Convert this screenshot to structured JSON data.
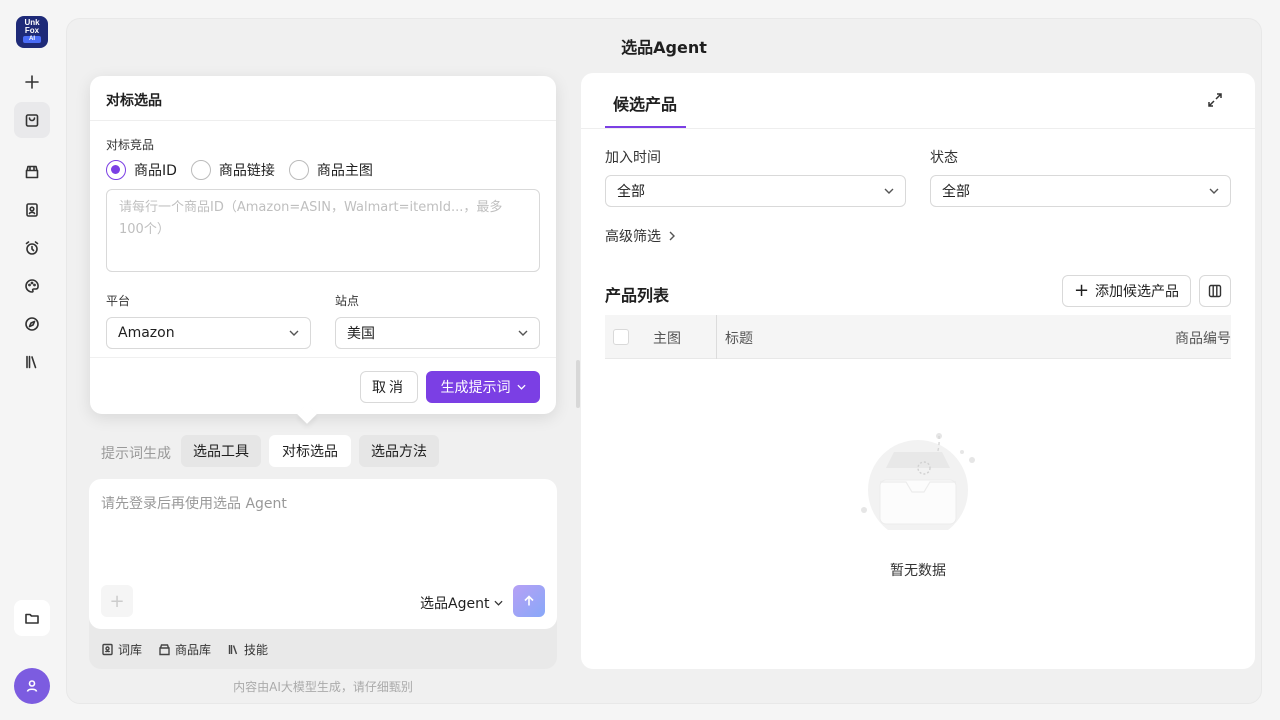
{
  "app": {
    "logo_line1": "Unk",
    "logo_line2": "Fox",
    "logo_badge": "AI",
    "page_title": "选品Agent"
  },
  "rail": {
    "icons": [
      "plus-icon",
      "shopping-bag-icon",
      "store-icon",
      "contacts-icon",
      "alarm-clock-icon",
      "palette-icon",
      "compass-icon",
      "library-icon",
      "folder-icon",
      "user-icon"
    ]
  },
  "popover": {
    "title": "对标选品",
    "competitor_label": "对标竞品",
    "radio_options": [
      "商品ID",
      "商品链接",
      "商品主图"
    ],
    "selected_radio": "商品ID",
    "textarea_placeholder": "请每行一个商品ID（Amazon=ASIN，Walmart=itemId...，最多100个）",
    "platform_label": "平台",
    "platform_value": "Amazon",
    "site_label": "站点",
    "site_value": "美国",
    "cancel_label": "取消",
    "generate_label": "生成提示词"
  },
  "prompt": {
    "label": "提示词生成",
    "chips": [
      "选品工具",
      "对标选品",
      "选品方法"
    ],
    "selected_chip": "对标选品"
  },
  "chat": {
    "placeholder": "请先登录后再使用选品 Agent",
    "agent_select": "选品Agent",
    "tools": [
      "词库",
      "商品库",
      "技能"
    ],
    "disclaimer": "内容由AI大模型生成，请仔细甄别"
  },
  "right": {
    "tab": "候选产品",
    "filter_time_label": "加入时间",
    "filter_time_value": "全部",
    "filter_status_label": "状态",
    "filter_status_value": "全部",
    "advanced_filter": "高级筛选",
    "list_title": "产品列表",
    "add_button": "添加候选产品",
    "columns": [
      "主图",
      "标题",
      "商品编号"
    ],
    "empty_text": "暂无数据"
  },
  "colors": {
    "accent": "#7b3fe4",
    "avatar": "#7c5ce0",
    "logo_bg": "#1e2a78"
  }
}
